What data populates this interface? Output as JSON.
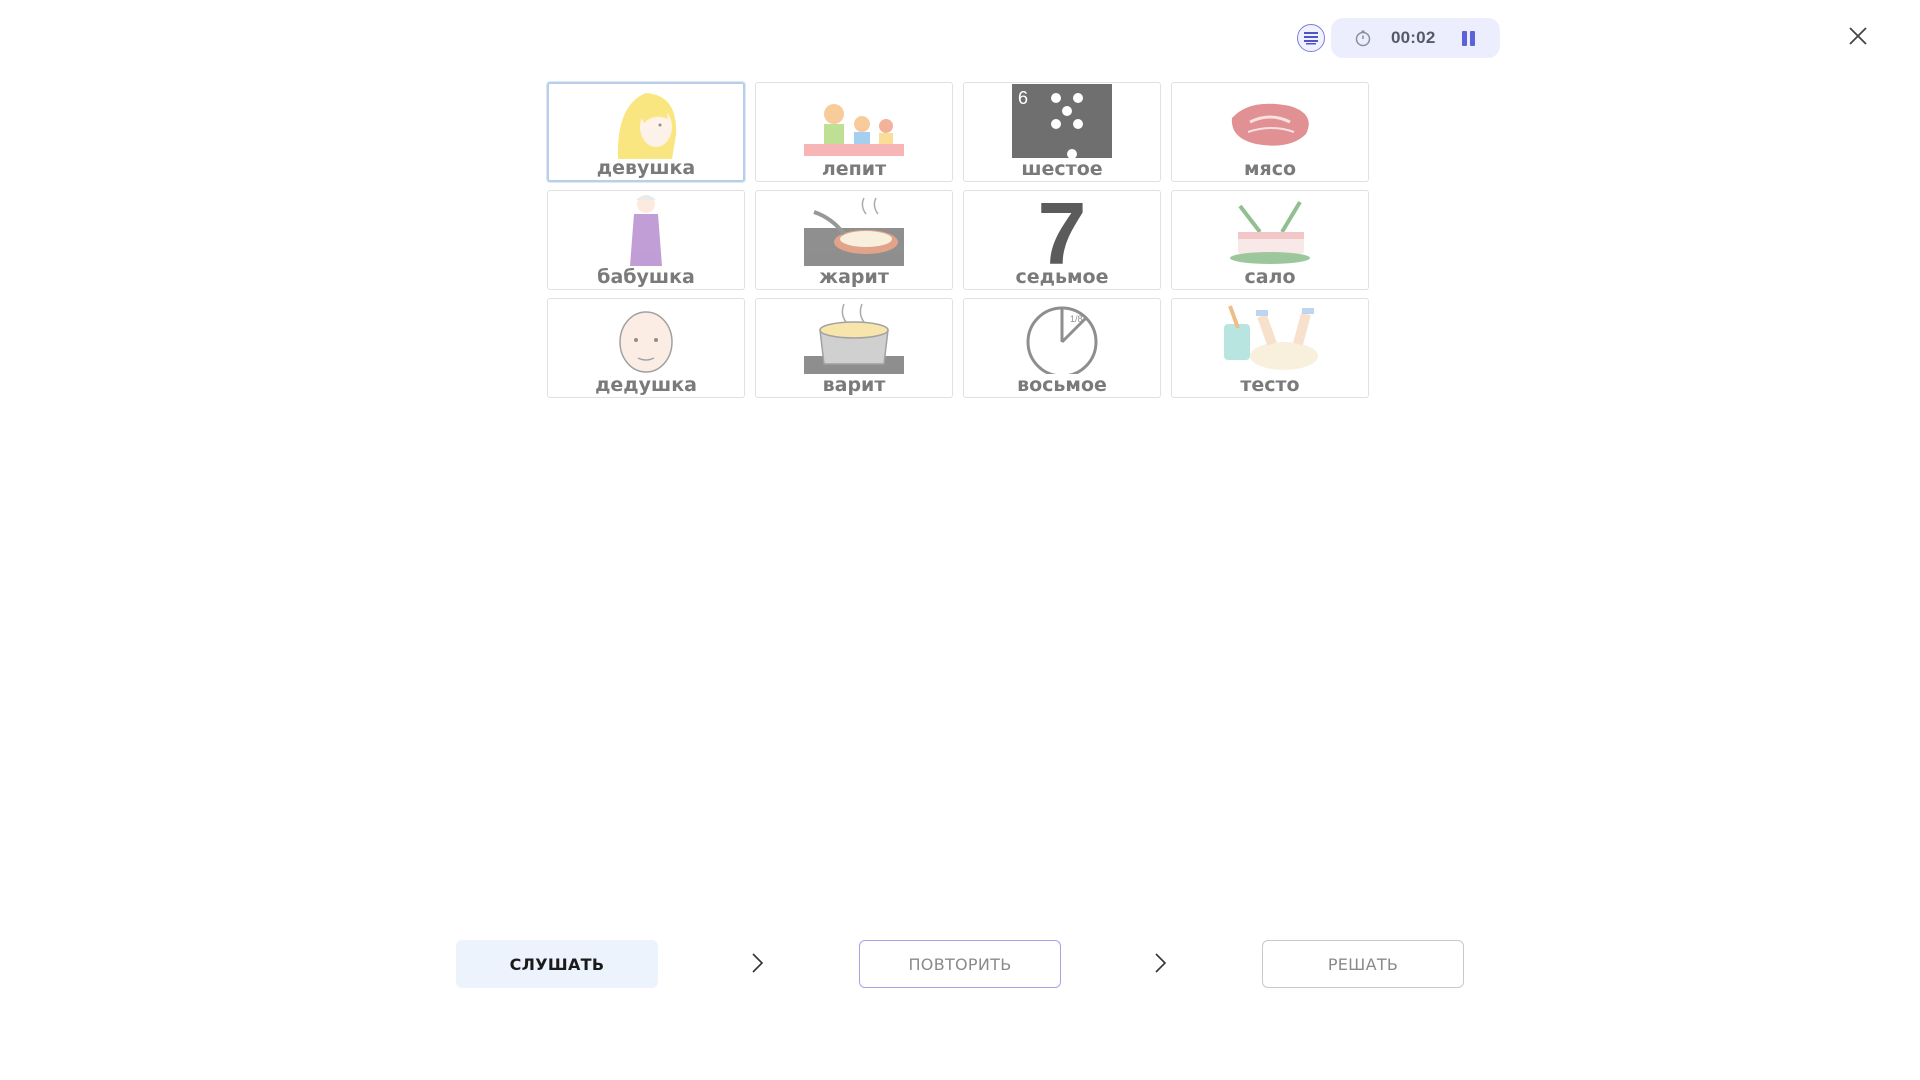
{
  "header": {
    "timer": "00:02",
    "list_icon": "list-icon",
    "timer_icon": "stopwatch-icon",
    "pause_icon": "pause-icon",
    "close_icon": "close-icon",
    "accent_color": "#5c63d6"
  },
  "cards": [
    {
      "label": "девушка",
      "icon": "girl-image",
      "selected": true
    },
    {
      "label": "лепит",
      "icon": "sculpting-family-image"
    },
    {
      "label": "шестое",
      "icon": "dice-six-image",
      "corner_number": "6"
    },
    {
      "label": "мясо",
      "icon": "meat-image"
    },
    {
      "label": "бабушка",
      "icon": "grandmother-image"
    },
    {
      "label": "жарит",
      "icon": "frying-pan-image"
    },
    {
      "label": "седьмое",
      "icon": "number-seven-image",
      "big_number": "7"
    },
    {
      "label": "сало",
      "icon": "lard-image"
    },
    {
      "label": "дедушка",
      "icon": "grandfather-image"
    },
    {
      "label": "варит",
      "icon": "cooking-pot-image"
    },
    {
      "label": "восьмое",
      "icon": "clock-eighth-image",
      "fraction": "1/8"
    },
    {
      "label": "тесто",
      "icon": "dough-image"
    }
  ],
  "controls": {
    "listen": "СЛУШАТЬ",
    "repeat": "ПОВТОРИТЬ",
    "solve": "РЕШАТЬ",
    "arrow_icon": "chevron-right-icon"
  }
}
